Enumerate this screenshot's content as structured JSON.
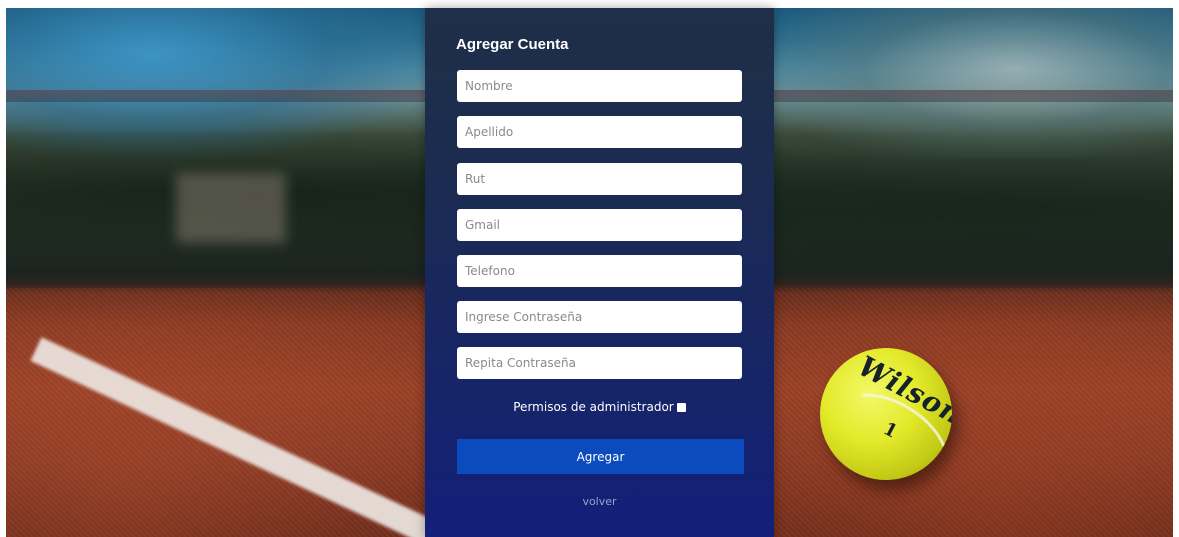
{
  "form": {
    "title": "Agregar Cuenta",
    "fields": [
      {
        "placeholder": "Nombre"
      },
      {
        "placeholder": "Apellido"
      },
      {
        "placeholder": "Rut"
      },
      {
        "placeholder": "Gmail"
      },
      {
        "placeholder": "Telefono"
      },
      {
        "placeholder": "Ingrese Contraseña"
      },
      {
        "placeholder": "Repita Contraseña"
      }
    ],
    "admin_label": "Permisos de administrador",
    "admin_checked": false,
    "submit_label": "Agregar",
    "back_label": "volver"
  },
  "background": {
    "ball_brand": "Wilson",
    "ball_number": "1"
  },
  "colors": {
    "panel_top": "#1f2f47",
    "panel_bottom": "#131f7a",
    "button": "#0b4bbd",
    "link": "#9aa4c8"
  }
}
